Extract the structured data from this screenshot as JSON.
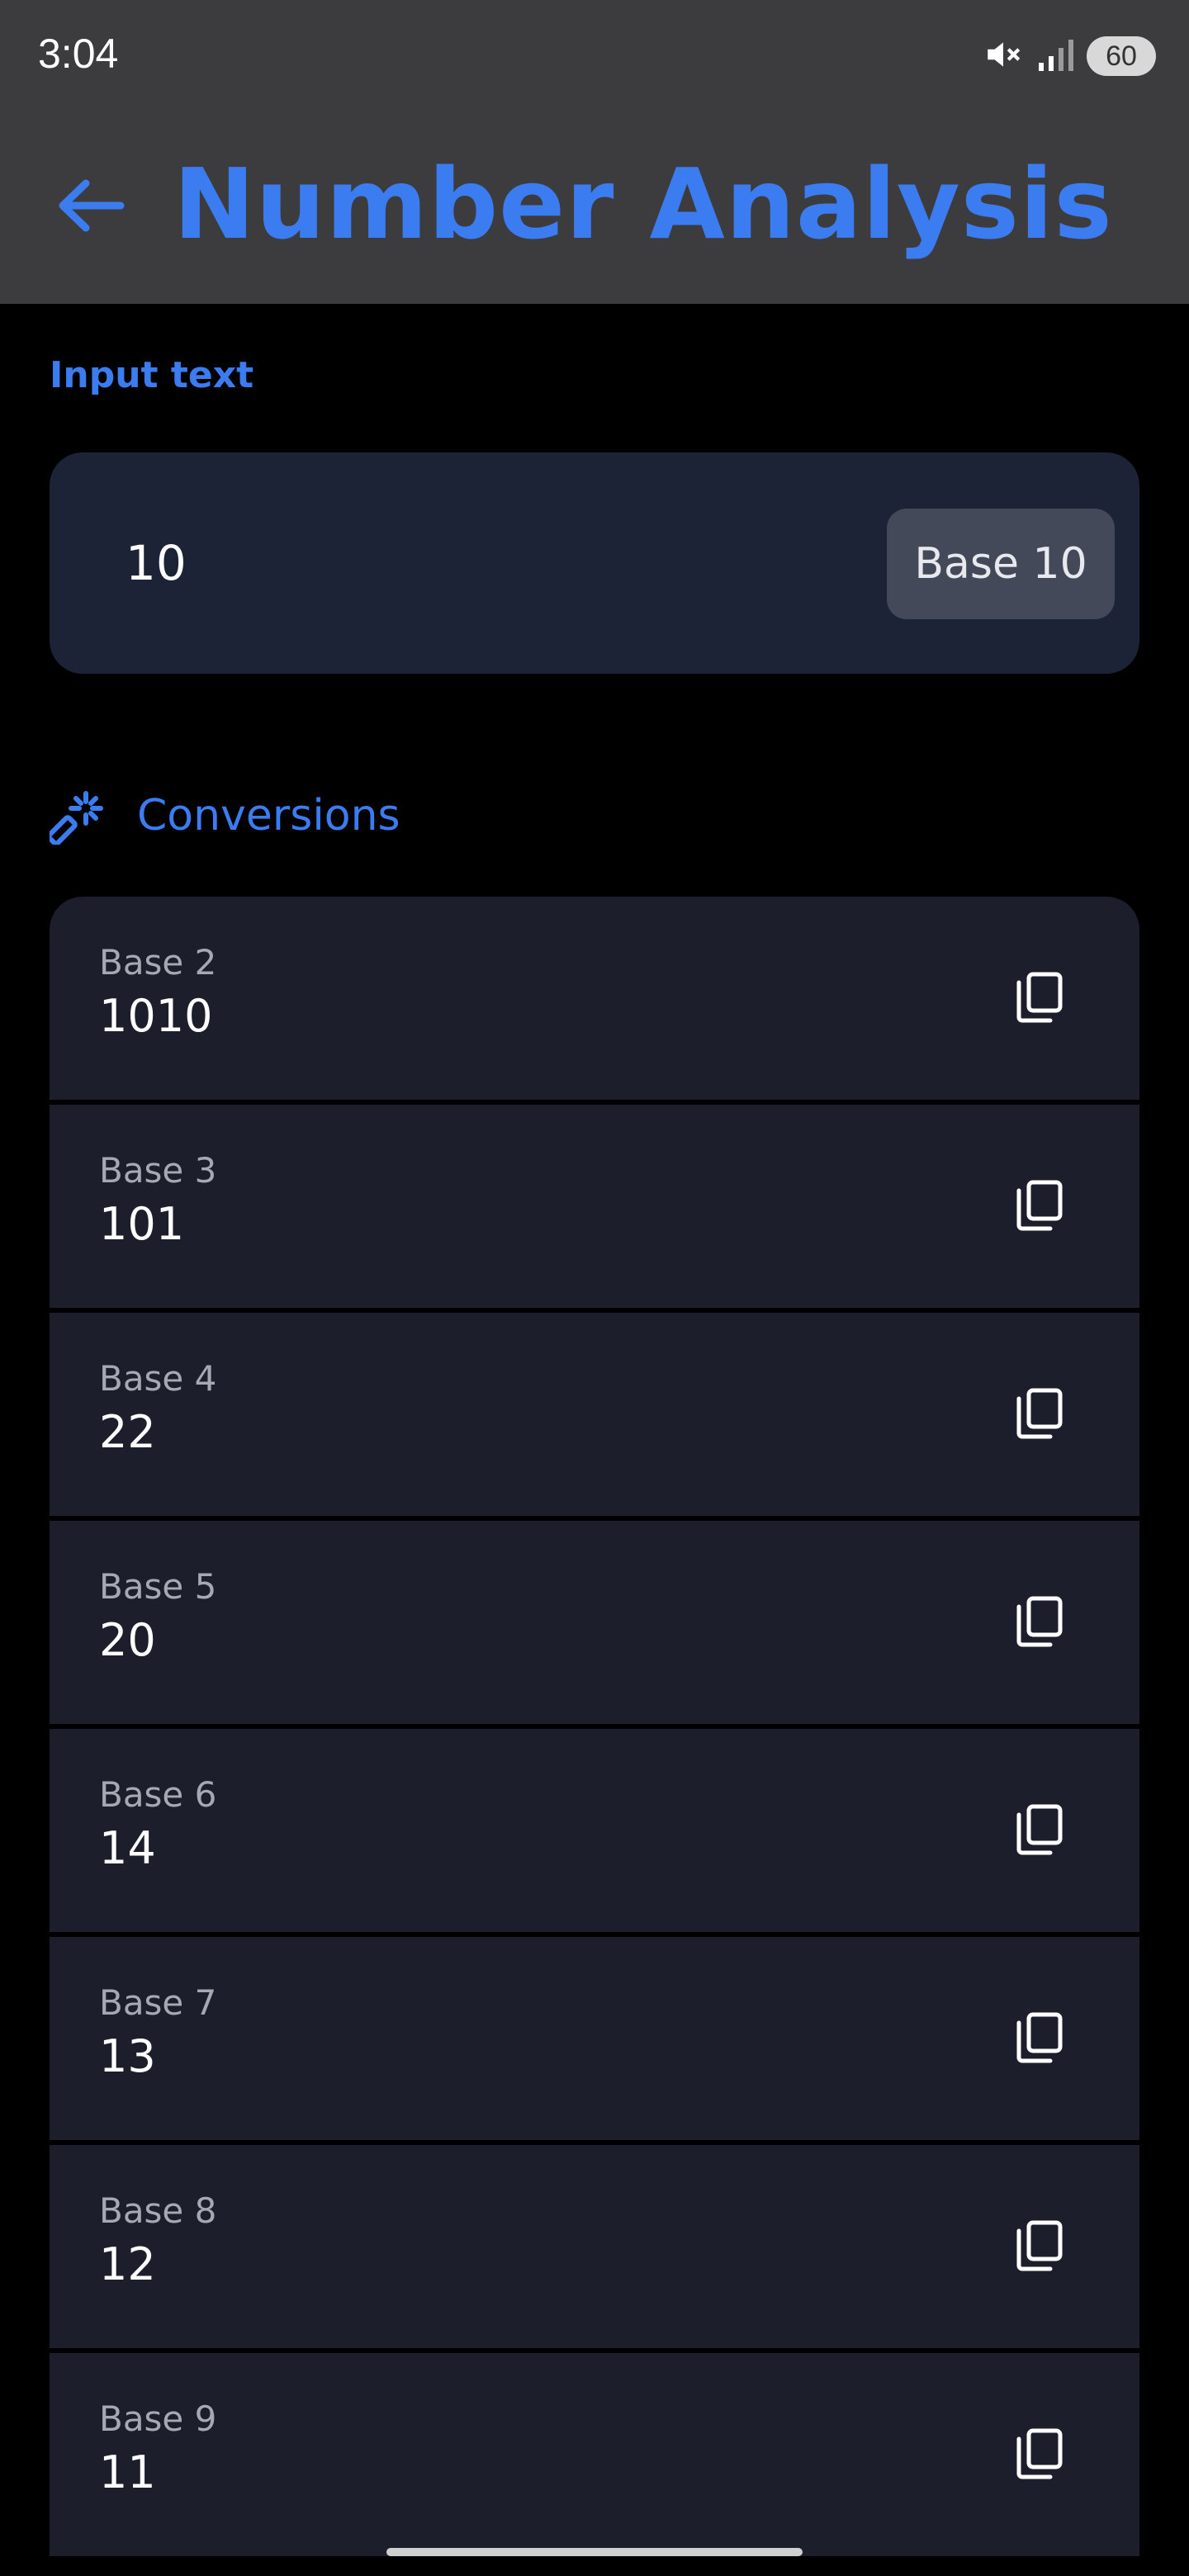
{
  "status_bar": {
    "time": "3:04",
    "battery": "60",
    "icons": [
      "mute-icon",
      "signal-icon",
      "battery-icon"
    ]
  },
  "app_bar": {
    "title": "Number Analysis",
    "back_icon": "arrow-left-icon"
  },
  "input": {
    "label": "Input text",
    "value": "10",
    "base": "Base 10"
  },
  "conversions": {
    "title": "Conversions",
    "icon": "magic-wand-icon",
    "items": [
      {
        "label": "Base 2",
        "value": "1010"
      },
      {
        "label": "Base 3",
        "value": "101"
      },
      {
        "label": "Base 4",
        "value": "22"
      },
      {
        "label": "Base 5",
        "value": "20"
      },
      {
        "label": "Base 6",
        "value": "14"
      },
      {
        "label": "Base 7",
        "value": "13"
      },
      {
        "label": "Base 8",
        "value": "12"
      },
      {
        "label": "Base 9",
        "value": "11"
      }
    ]
  },
  "colors": {
    "accent": "#3b7cf1",
    "app_bar": "#3c3c3e",
    "background": "#000000",
    "input_card": "#1c2336",
    "row": "#1c1f2b"
  }
}
